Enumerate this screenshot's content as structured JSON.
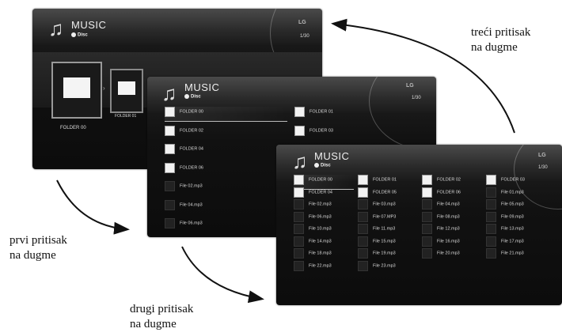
{
  "screen_top": {
    "title": "MUSIC",
    "source": "Disc",
    "brand": "LG",
    "page": "1/30",
    "folder_label": "FOLDER 00",
    "next_label": "FOLDER 01"
  },
  "screen_mid": {
    "title": "MUSIC",
    "source": "Disc",
    "brand": "LG",
    "page": "1/30",
    "left": [
      "FOLDER 00",
      "FOLDER 02",
      "FOLDER 04",
      "FOLDER 06",
      "File 02.mp3",
      "File 04.mp3",
      "File 06.mp3"
    ],
    "right": [
      "FOLDER 01",
      "FOLDER 03"
    ]
  },
  "screen_front": {
    "title": "MUSIC",
    "source": "Disc",
    "brand": "LG",
    "page": "1/30",
    "rows": [
      [
        "FOLDER 00",
        "FOLDER 01",
        "FOLDER 02",
        "FOLDER 03"
      ],
      [
        "FOLDER 04",
        "FOLDER 05",
        "FOLDER 06",
        "File 01.mp3"
      ],
      [
        "File 02.mp3",
        "File 03.mp3",
        "File 04.mp3",
        "File 05.mp3"
      ],
      [
        "File 06.mp3",
        "File 07.MP3",
        "File 08.mp3",
        "File 09.mp3"
      ],
      [
        "File 10.mp3",
        "File 11.mp3",
        "File 12.mp3",
        "File 13.mp3"
      ],
      [
        "File 14.mp3",
        "File 15.mp3",
        "File 16.mp3",
        "File 17.mp3"
      ],
      [
        "File 18.mp3",
        "File 19.mp3",
        "File 20.mp3",
        "File 21.mp3"
      ],
      [
        "File 22.mp3",
        "File 23.mp3",
        "",
        ""
      ]
    ]
  },
  "captions": {
    "first_l1": "prvi pritisak",
    "first_l2": "na dugme",
    "second_l1": "drugi pritisak",
    "second_l2": "na dugme",
    "third_l1": "treći pritisak",
    "third_l2": "na dugme"
  }
}
